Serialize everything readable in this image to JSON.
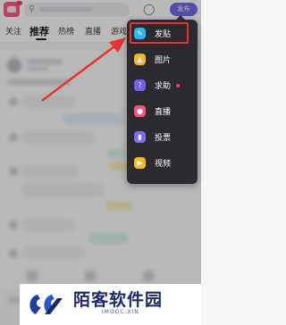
{
  "topbar": {
    "publish_label": "发布"
  },
  "tabs": [
    {
      "label": "关注"
    },
    {
      "label": "推荐"
    },
    {
      "label": "热榜"
    },
    {
      "label": "直播"
    },
    {
      "label": "游戏"
    }
  ],
  "menu": {
    "items": [
      {
        "label": "发贴",
        "icon": "pencil-icon",
        "color": "#2fb5f0"
      },
      {
        "label": "图片",
        "icon": "image-icon",
        "color": "#f6b233"
      },
      {
        "label": "求助",
        "icon": "question-icon",
        "color": "#7b5cf5"
      },
      {
        "label": "直播",
        "icon": "live-icon",
        "color": "#f2557c"
      },
      {
        "label": "投票",
        "icon": "vote-icon",
        "color": "#7d6bf5"
      },
      {
        "label": "视频",
        "icon": "video-icon",
        "color": "#f7b825"
      }
    ],
    "help_dot_color": "#ff3b4e",
    "highlight_color": "#e8332e"
  },
  "watermark": {
    "title": "陌客软件园",
    "subtitle": "IMOOC.XIN"
  }
}
